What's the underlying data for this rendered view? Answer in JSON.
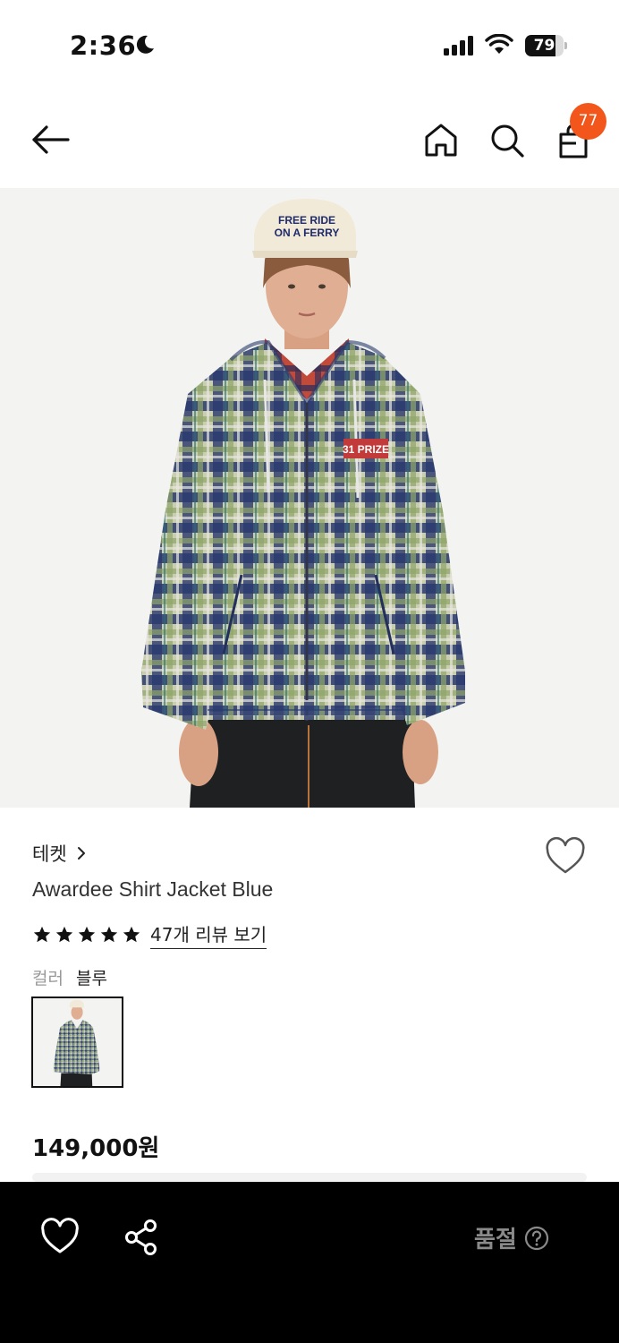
{
  "status_bar": {
    "time": "2:36",
    "battery": "79",
    "battery_level": 0.79
  },
  "nav": {
    "cart_count": "77"
  },
  "product": {
    "brand": "테켓",
    "name": "Awardee Shirt Jacket Blue",
    "rating_stars": 5,
    "review_link": "47개 리뷰 보기",
    "color_label": "컬러",
    "color_value": "블루",
    "price": "149,000원",
    "hero_cap_text_1": "FREE RIDE",
    "hero_cap_text_2": "ON A FERRY",
    "hero_patch_text": "31 PRIZE"
  },
  "bottom_bar": {
    "status": "품절"
  },
  "colors": {
    "badge": "#f2561b",
    "bottom_bar": "#000000",
    "soldout_text": "#8a8a8a"
  }
}
